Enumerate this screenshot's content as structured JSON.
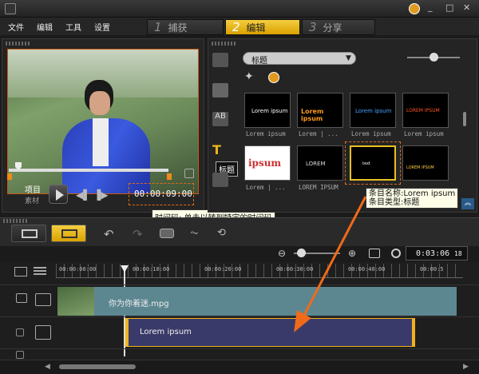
{
  "titlebar": {
    "min": "_",
    "max": "□",
    "close": "✕"
  },
  "menu": [
    "文件",
    "编辑",
    "工具",
    "设置"
  ],
  "steps": [
    {
      "num": "1",
      "label": "捕获"
    },
    {
      "num": "2",
      "label": "编辑"
    },
    {
      "num": "3",
      "label": "分享"
    }
  ],
  "preview": {
    "mode_project": "项目",
    "mode_clip": "素材",
    "timecode": "00:00:09:00",
    "timecode_tooltip": "时间码: 单击以转到特定的时间码"
  },
  "library": {
    "category": "标题",
    "category_tooltip": "标题",
    "thumbs": [
      {
        "caption": "Lorem ipsum",
        "text": "Lorem ipsum",
        "color": "#ffffff"
      },
      {
        "caption": "Lorem | ...",
        "text": "Lorem ipsum",
        "color": "#ff9a1a"
      },
      {
        "caption": "Lorem ipsum",
        "text": "Lorem ipsum",
        "color": "#4aa0ff"
      },
      {
        "caption": "Lorem ipsum",
        "text": "LOREM IPSUM",
        "color": "#ff5522"
      },
      {
        "caption": "Lorem | ...",
        "text": "ipsum",
        "color": "#cc3030"
      },
      {
        "caption": "LOREM IPSUM",
        "text": "LOREM",
        "color": "#dddddd"
      },
      {
        "caption": "",
        "text": "text",
        "color": "#ffffff"
      },
      {
        "caption": "",
        "text": "LOREM IPSUM",
        "color": "#ffcc44"
      }
    ],
    "item_tooltip_line1": "条目名称:Lorem ipsum",
    "item_tooltip_line2": "条目类型:标题"
  },
  "timeline": {
    "total_time": "0:03:06",
    "frames": "18",
    "ruler": [
      "00:00:00:00",
      "00:00:10:00",
      "00:00:20:00",
      "00:00:30:00",
      "00:00:40:00",
      "00:00:5"
    ],
    "video_clip_label": "你为你着迷.mpg",
    "title_clip_label": "Lorem ipsum"
  },
  "colors": {
    "accent": "#f0b41a",
    "video_track": "#5c8791",
    "title_clip": "#3a3a6a",
    "arrow": "#f06a1a"
  }
}
